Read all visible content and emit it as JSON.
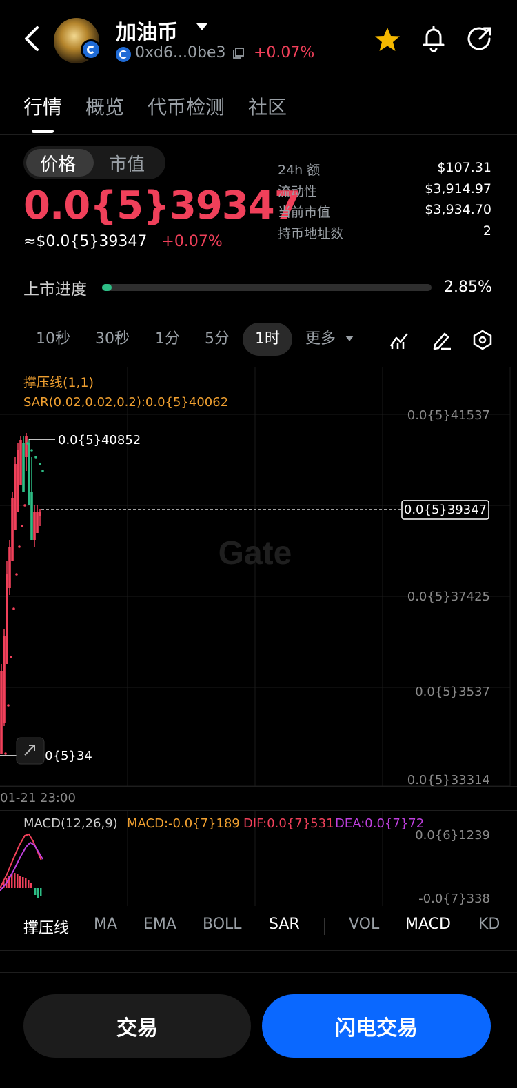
{
  "header": {
    "title": "加油币",
    "address": "0xd6...0be3",
    "change": "+0.07%"
  },
  "tabs": [
    "行情",
    "概览",
    "代币检测",
    "社区"
  ],
  "price_toggle": [
    "价格",
    "市值"
  ],
  "price": {
    "main": "0.0{5}39347",
    "approx": "≈$0.0{5}39347",
    "change": "+0.07%"
  },
  "stats": [
    {
      "label": "24h  额",
      "value": "$107.31"
    },
    {
      "label": "流动性",
      "value": "$3,914.97"
    },
    {
      "label": "当前市值",
      "value": "$3,934.70"
    },
    {
      "label": "持币地址数",
      "value": "2"
    }
  ],
  "listing": {
    "label": "上市进度",
    "value": "2.85%",
    "fraction": 0.0285
  },
  "intervals": [
    "10秒",
    "30秒",
    "1分",
    "5分",
    "1时",
    "更多"
  ],
  "active_interval": "1时",
  "chart": {
    "indicator_title": "撑压线(1,1)",
    "sar_label": "SAR(0.02,0.02,0.2):0.0{5}40062",
    "y_labels": [
      "0.0{5}41537",
      "0.0{5}37425",
      "0.0{5}3537",
      "0.0{5}33314"
    ],
    "high_label": "0.0{5}40852",
    "low_label": "0.0{5}34",
    "current_label": "0.0{5}39347",
    "time_label": "01-21 23:00",
    "watermark": "Gate"
  },
  "macd": {
    "title": "MACD(12,26,9)",
    "macd": "MACD:-0.0{7}189",
    "dif": "DIF:0.0{7}531",
    "dea": "DEA:0.0{7}72",
    "y_top": "0.0{6}1239",
    "y_bottom": "-0.0{7}338"
  },
  "indicator_tabs": [
    "撑压线",
    "MA",
    "EMA",
    "BOLL",
    "SAR",
    "VOL",
    "MACD",
    "KD"
  ],
  "buttons": {
    "trade": "交易",
    "flash": "闪电交易"
  },
  "colors": {
    "up": "#f0405a",
    "down": "#2dbd85",
    "sar": "#2dbd85",
    "accent": "#0a68ff",
    "label_orange": "#f0a030",
    "dea": "#c040e0"
  }
}
